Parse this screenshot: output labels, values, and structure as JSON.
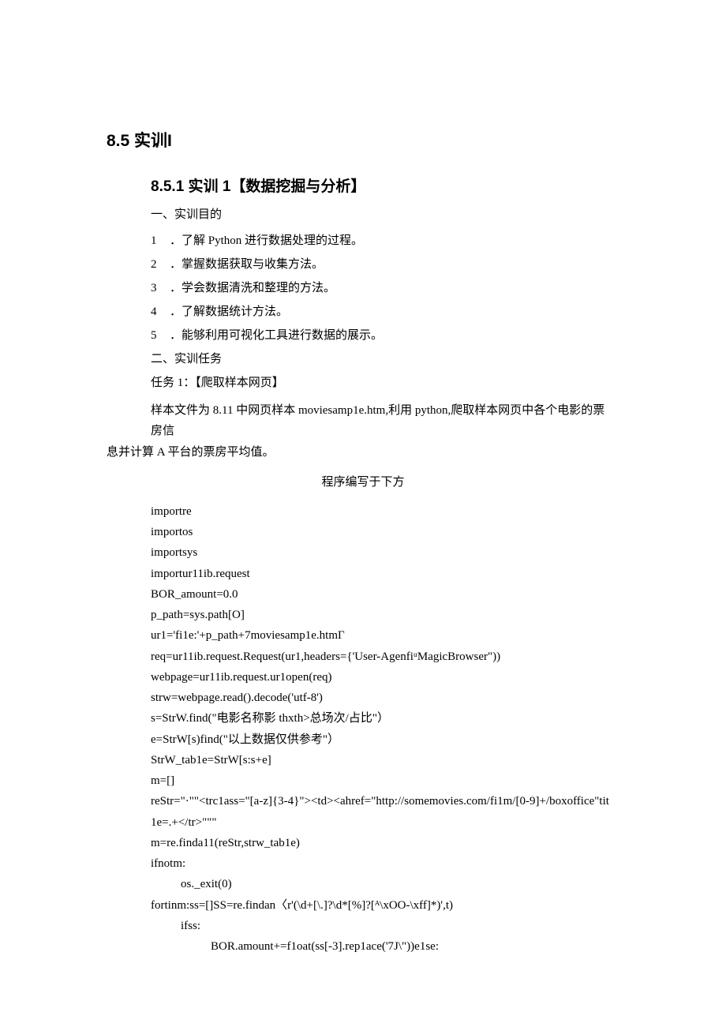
{
  "h1": "8.5 实训Ι",
  "h2": "8.5.1 实训 1【数据挖掘与分析】",
  "section1_title": "一、实训目的",
  "objectives": [
    {
      "num": "1",
      "text": "．了解 Python 进行数据处理的过程。"
    },
    {
      "num": "2",
      "text": "．掌握数据获取与收集方法。"
    },
    {
      "num": "3",
      "text": "．学会数据清洗和整理的方法。"
    },
    {
      "num": "4",
      "text": "．了解数据统计方法。"
    },
    {
      "num": "5",
      "text": "．能够利用可视化工具进行数据的展示。"
    }
  ],
  "section2_title": "二、实训任务",
  "task_title": "任务 1：【爬取样本网页】",
  "task_body_1": "样本文件为 8.11 中网页样本 moviesamp1e.htm,利用 python,爬取样本网页中各个电影的票房信",
  "task_body_2": "息并计算 A 平台的票房平均值。",
  "code_caption": "程序编写于下方",
  "code": [
    {
      "indent": 0,
      "text": "importre"
    },
    {
      "indent": 0,
      "text": "importos"
    },
    {
      "indent": 0,
      "text": "importsys"
    },
    {
      "indent": 0,
      "text": "importur11ib.request"
    },
    {
      "indent": 0,
      "text": "BOR_amount=0.0"
    },
    {
      "indent": 0,
      "text": "p_path=sys.path[O]"
    },
    {
      "indent": 0,
      "text": "ur1='fi1e:'+p_path+7moviesamp1e.htmΓ"
    },
    {
      "indent": 0,
      "text": "req=ur11ib.request.Request(ur1,headers={'User-AgenfiᵘMagicBrowser\"))"
    },
    {
      "indent": 0,
      "text": "webpage=ur11ib.request.ur1open(req)"
    },
    {
      "indent": 0,
      "text": "strw=webpage.read().decode('utf-8')"
    },
    {
      "indent": 0,
      "text": "s=StrW.find(\"电影名称影 thxth>总场次/占比\"）"
    },
    {
      "indent": 0,
      "text": "e=StrW[s)find(\"以上数据仅供参考\"）"
    },
    {
      "indent": 0,
      "text": "StrW_tab1e=StrW[s:s+e]"
    },
    {
      "indent": 0,
      "text": "m=[]"
    },
    {
      "indent": 0,
      "text": "reStr=\"·\"\"<trc1ass=\"[a-z]{3-4}\"><td><ahref=\"http://somemovies.com/fi1m/[0-9]+/boxoffice\"tit1e=.+</tr>\"\"\""
    },
    {
      "indent": 0,
      "text": "m=re.finda11(reStr,strw_tab1e)"
    },
    {
      "indent": 0,
      "text": "ifnotm:"
    },
    {
      "indent": 1,
      "text": "os._exit(0)"
    },
    {
      "indent": 0,
      "text": "fortinm:ss=[]SS=re.findan〈r'(\\d+[\\.]?\\d*[%]?[ᴬ\\xOO-\\xff]*)',t)"
    },
    {
      "indent": 1,
      "text": "ifss:"
    },
    {
      "indent": 2,
      "text": "BOR.amount+=f1oat(ss[-3].rep1ace('7J\\\"))e1se:"
    }
  ]
}
